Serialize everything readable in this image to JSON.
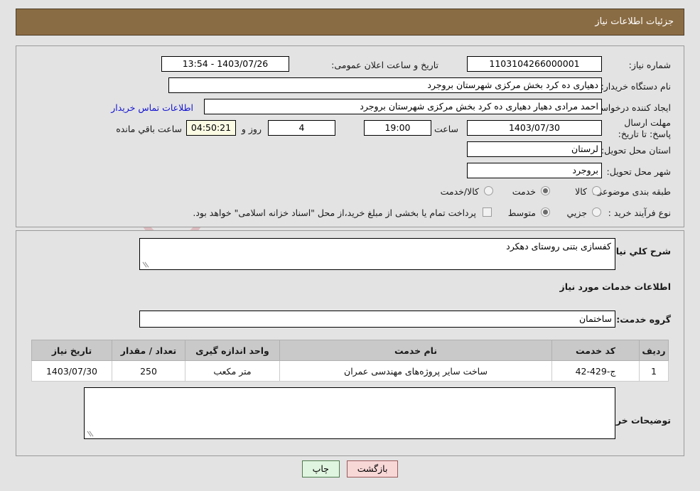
{
  "header": {
    "title": "جزئیات اطلاعات نیاز"
  },
  "colors": {
    "header_bar": "#8a6c44",
    "panel_bg": "#e3e3e3",
    "link": "#1414d2",
    "countdown_field": "#fbfbe4",
    "print_button": "#e0f5e0",
    "back_button": "#f8d7d7",
    "table_header": "#c9c9c9"
  },
  "top_form": {
    "need_number_label": "شماره نیاز:",
    "need_number_value": "1103104266000001",
    "public_announce_label": "تاریخ و ساعت اعلان عمومی:",
    "public_announce_value": "1403/07/26 - 13:54",
    "buyer_org_label": "نام دستگاه خریدار:",
    "buyer_org_value": "دهیاری ده کرد بخش مرکزی شهرستان بروجرد",
    "creator_label": "ایجاد کننده درخواست:",
    "creator_value": "احمد مرادی دهیار دهیاری ده کرد بخش مرکزی شهرستان بروجرد",
    "contact_link": "اطلاعات تماس خریدار",
    "deadline_label": "مهلت ارسال پاسخ: تا تاریخ:",
    "deadline_date": "1403/07/30",
    "hour_label": "ساعت",
    "hour_value": "19:00",
    "days_value": "4",
    "days_label": "روز و",
    "countdown_value": "04:50:21",
    "countdown_label": "ساعت باقي مانده",
    "province_label": "استان محل تحویل:",
    "province_value": "لرستان",
    "city_label": "شهر محل تحویل:",
    "city_value": "بروجرد",
    "category_label": "طبقه بندی موضوعی:",
    "category_options": [
      {
        "label": "کالا",
        "selected": false
      },
      {
        "label": "خدمت",
        "selected": true
      },
      {
        "label": "کالا/خدمت",
        "selected": false
      }
    ],
    "process_label": "نوع فرآیند خرید :",
    "process_options": [
      {
        "label": "جزیي",
        "selected": false
      },
      {
        "label": "متوسط",
        "selected": true
      }
    ],
    "treasury_checkbox_label": "پرداخت تمام یا بخشی از مبلغ خرید،از محل \"اسناد خزانه اسلامی\" خواهد بود.",
    "treasury_checked": false
  },
  "mid_form": {
    "general_desc_label": "شرح کلي نیاز:",
    "general_desc_value": "کفسازی بتنی روستای دهکرد",
    "services_info_heading": "اطلاعات خدمات مورد نیاز",
    "service_group_label": "گروه خدمت:",
    "service_group_value": "ساختمان",
    "buyer_notes_label": "توضیحات خریدار:",
    "buyer_notes_value": ""
  },
  "table": {
    "columns": [
      "ردیف",
      "کد خدمت",
      "نام خدمت",
      "واحد اندازه گیری",
      "تعداد / مقدار",
      "تاریخ نیاز"
    ],
    "rows": [
      {
        "row": "1",
        "code": "ج-429-42",
        "name": "ساخت سایر پروژه‌های مهندسی عمران",
        "unit": "متر مکعب",
        "qty": "250",
        "date": "1403/07/30"
      }
    ]
  },
  "footer": {
    "print_label": "چاپ",
    "back_label": "بازگشت"
  },
  "watermark": {
    "text": "AriaTender.net"
  }
}
